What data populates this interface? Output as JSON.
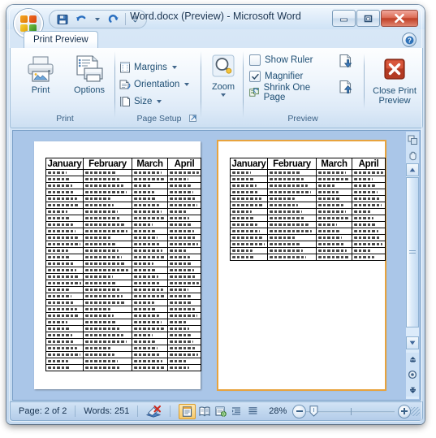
{
  "window": {
    "title": "Word.docx (Preview) - Microsoft Word",
    "minimize_label": "–",
    "maximize_label": "□",
    "close_label": "✕"
  },
  "quick_access": {
    "office_button": "office-button",
    "items": [
      {
        "name": "save",
        "icon": "save-icon",
        "label": "Save"
      },
      {
        "name": "undo",
        "icon": "undo-icon",
        "label": "Undo"
      },
      {
        "name": "redo",
        "icon": "redo-icon",
        "label": "Redo"
      }
    ],
    "customize_label": "Customize Quick Access Toolbar"
  },
  "tabs": [
    {
      "id": "print-preview",
      "label": "Print Preview",
      "active": true
    }
  ],
  "help": {
    "label": "?"
  },
  "ribbon": {
    "groups": [
      {
        "id": "print",
        "label": "Print",
        "buttons": [
          {
            "name": "print",
            "label": "Print",
            "icon": "printer-icon"
          },
          {
            "name": "options",
            "label": "Options",
            "icon": "options-page-icon"
          }
        ]
      },
      {
        "id": "page-setup",
        "label": "Page Setup",
        "has_dialog_launcher": true,
        "items": [
          {
            "name": "margins",
            "label": "Margins",
            "icon": "margins-icon",
            "dropdown": true
          },
          {
            "name": "orientation",
            "label": "Orientation",
            "icon": "orientation-icon",
            "dropdown": true
          },
          {
            "name": "size",
            "label": "Size",
            "icon": "size-icon",
            "dropdown": true
          }
        ]
      },
      {
        "id": "zoom",
        "label": "",
        "buttons": [
          {
            "name": "zoom",
            "label": "Zoom",
            "icon": "magnifier-icon",
            "dropdown": true
          }
        ]
      },
      {
        "id": "preview",
        "label": "Preview",
        "checkboxes": [
          {
            "name": "show-ruler",
            "label": "Show Ruler",
            "checked": false
          },
          {
            "name": "magnifier",
            "label": "Magnifier",
            "checked": true
          }
        ],
        "items": [
          {
            "name": "shrink-one-page",
            "label": "Shrink One Page",
            "icon": "shrink-one-page-icon"
          }
        ],
        "nav_buttons": [
          {
            "name": "next-page",
            "label": "Next Page",
            "icon": "next-page-icon"
          },
          {
            "name": "previous-page",
            "label": "Previous Page",
            "icon": "previous-page-icon"
          }
        ],
        "close_button": {
          "name": "close-print-preview",
          "label_line1": "Close Print",
          "label_line2": "Preview",
          "icon": "close-x-icon"
        }
      }
    ]
  },
  "document": {
    "zoom_percent": "28%",
    "pages": [
      {
        "number": 1,
        "selected": false,
        "table_rows": 31
      },
      {
        "number": 2,
        "selected": true,
        "table_rows": 14
      }
    ],
    "table": {
      "headers": [
        "January",
        "February",
        "March",
        "April"
      ]
    }
  },
  "scrollbar": {
    "select_browse_object": "select-browse-object",
    "hand_tool": "hand-tool-icon",
    "previous_page": "previous-page-icon",
    "next_page": "next-page-icon"
  },
  "status_bar": {
    "page_label": "Page: 2 of 2",
    "words_label": "Words: 251",
    "proofing_icon": "proofing-errors-icon",
    "views": [
      {
        "name": "print-layout",
        "label": "Print Layout",
        "active": true
      },
      {
        "name": "full-screen-reading",
        "label": "Full Screen Reading",
        "active": false
      },
      {
        "name": "web-layout",
        "label": "Web Layout",
        "active": false
      },
      {
        "name": "outline",
        "label": "Outline",
        "active": false
      },
      {
        "name": "draft",
        "label": "Draft",
        "active": false
      }
    ],
    "zoom_percent": "28%",
    "zoom_out_label": "Zoom Out",
    "zoom_in_label": "Zoom In"
  }
}
